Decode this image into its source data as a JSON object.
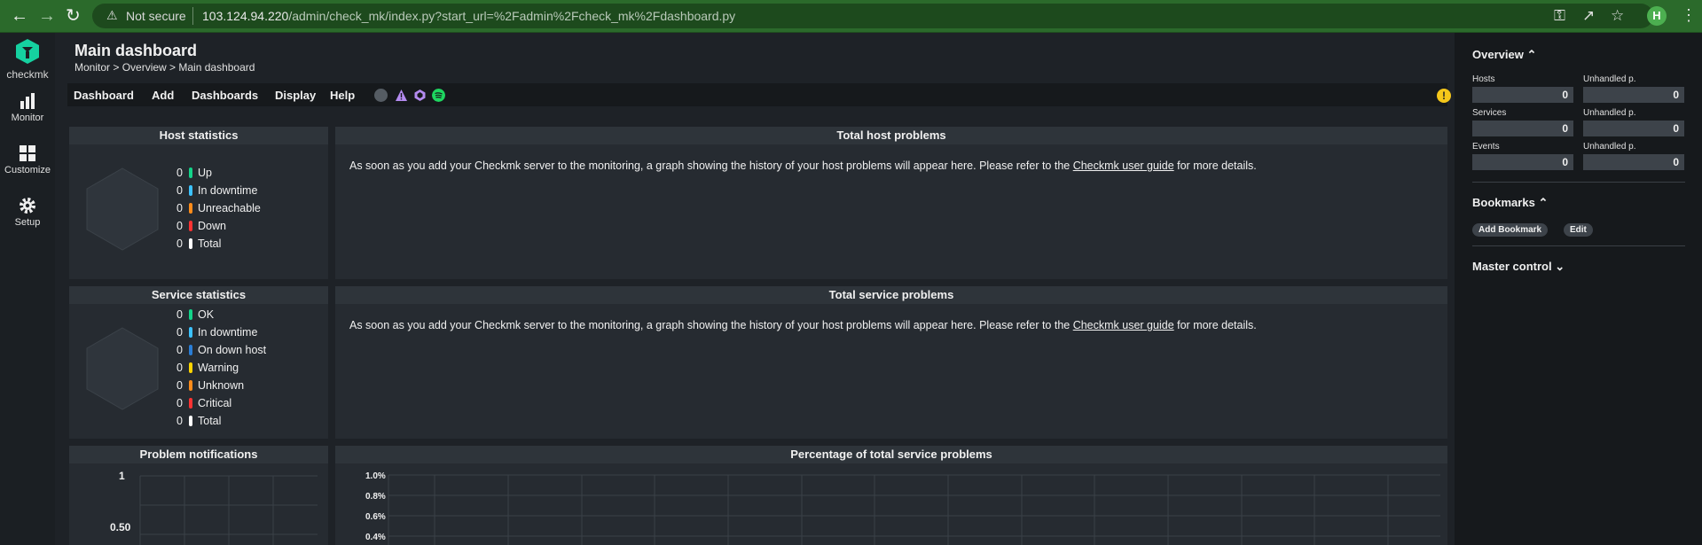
{
  "browser": {
    "security_label": "Not secure",
    "url_host": "103.124.94.220",
    "url_path": "/admin/check_mk/index.py?start_url=%2Fadmin%2Fcheck_mk%2Fdashboard.py",
    "avatar_letter": "H"
  },
  "sidebar": {
    "logo_text": "checkmk",
    "items": [
      {
        "label": "Monitor",
        "icon": "bar-chart-icon"
      },
      {
        "label": "Customize",
        "icon": "grid-icon"
      },
      {
        "label": "Setup",
        "icon": "gear-icon"
      }
    ]
  },
  "header": {
    "title": "Main dashboard",
    "breadcrumb": "Monitor > Overview > Main dashboard"
  },
  "menubar": {
    "items": [
      "Dashboard",
      "Add",
      "Dashboards",
      "Display",
      "Help"
    ]
  },
  "dashlets": {
    "host_stats": {
      "title": "Host statistics",
      "rows": [
        {
          "count": "0",
          "label": "Up",
          "color": "#13d389"
        },
        {
          "count": "0",
          "label": "In downtime",
          "color": "#3cc2ff"
        },
        {
          "count": "0",
          "label": "Unreachable",
          "color": "#ff8c1a"
        },
        {
          "count": "0",
          "label": "Down",
          "color": "#ff3333"
        },
        {
          "count": "0",
          "label": "Total",
          "color": "#ffffff"
        }
      ]
    },
    "host_problems": {
      "title": "Total host problems",
      "message_before": "As soon as you add your Checkmk server to the monitoring, a graph showing the history of your host problems will appear here. Please refer to the ",
      "link": "Checkmk user guide",
      "message_after": " for more details."
    },
    "service_stats": {
      "title": "Service statistics",
      "rows": [
        {
          "count": "0",
          "label": "OK",
          "color": "#13d389"
        },
        {
          "count": "0",
          "label": "In downtime",
          "color": "#3cc2ff"
        },
        {
          "count": "0",
          "label": "On down host",
          "color": "#2a7ed6"
        },
        {
          "count": "0",
          "label": "Warning",
          "color": "#ffd400"
        },
        {
          "count": "0",
          "label": "Unknown",
          "color": "#ff8c1a"
        },
        {
          "count": "0",
          "label": "Critical",
          "color": "#ff3333"
        },
        {
          "count": "0",
          "label": "Total",
          "color": "#ffffff"
        }
      ]
    },
    "service_problems": {
      "title": "Total service problems",
      "message_before": "As soon as you add your Checkmk server to the monitoring, a graph showing the history of your host problems will appear here. Please refer to the ",
      "link": "Checkmk user guide",
      "message_after": " for more details."
    },
    "notifications": {
      "title": "Problem notifications",
      "y_ticks": [
        "1",
        "0.50"
      ]
    },
    "percentage": {
      "title": "Percentage of total service problems",
      "y_ticks": [
        "1.0%",
        "0.8%",
        "0.6%",
        "0.4%"
      ]
    }
  },
  "right_panel": {
    "overview": {
      "title": "Overview",
      "cells": [
        {
          "label": "Hosts",
          "value": "0"
        },
        {
          "label": "Unhandled p.",
          "value": "0"
        },
        {
          "label": "Services",
          "value": "0"
        },
        {
          "label": "Unhandled p.",
          "value": "0"
        },
        {
          "label": "Events",
          "value": "0"
        },
        {
          "label": "Unhandled p.",
          "value": "0"
        }
      ]
    },
    "bookmarks": {
      "title": "Bookmarks",
      "add_label": "Add Bookmark",
      "edit_label": "Edit"
    },
    "master_control": {
      "title": "Master control"
    }
  }
}
